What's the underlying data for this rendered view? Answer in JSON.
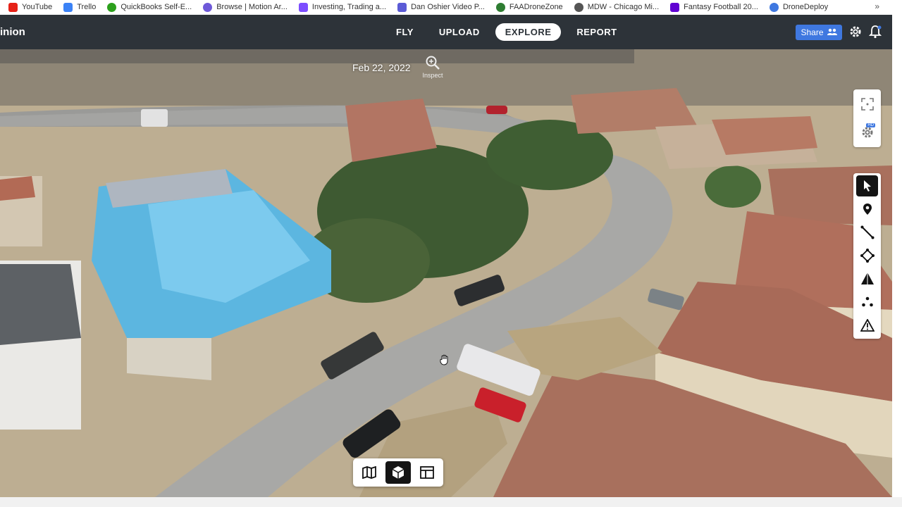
{
  "bookmarks": [
    {
      "label": "YouTube",
      "color": "#e62117"
    },
    {
      "label": "Trello",
      "color": "#3b82f6"
    },
    {
      "label": "QuickBooks Self-E...",
      "color": "#2ca01c"
    },
    {
      "label": "Browse | Motion Ar...",
      "color": "#6e59d9"
    },
    {
      "label": "Investing, Trading a...",
      "color": "#7c4dff"
    },
    {
      "label": "Dan Oshier Video P...",
      "color": "#5b5bd6"
    },
    {
      "label": "FAADroneZone",
      "color": "#2e7d32"
    },
    {
      "label": "MDW - Chicago Mi...",
      "color": "#555555"
    },
    {
      "label": "Fantasy Football 20...",
      "color": "#6001d2"
    },
    {
      "label": "DroneDeploy",
      "color": "#3f78e0"
    }
  ],
  "bookmarks_overflow": "»",
  "nav": {
    "project_title": "inion",
    "tabs": [
      {
        "label": "FLY",
        "active": false
      },
      {
        "label": "UPLOAD",
        "active": false
      },
      {
        "label": "EXPLORE",
        "active": true
      },
      {
        "label": "REPORT",
        "active": false
      }
    ],
    "share_label": "Share",
    "share_icon": "people-icon",
    "accent": "#3f78e0"
  },
  "map": {
    "date": "Feb 22, 2022",
    "inspect_label": "Inspect"
  },
  "right_panel_top": [
    {
      "name": "fit-view-icon"
    },
    {
      "name": "hd-settings-icon",
      "badge": "HD"
    }
  ],
  "right_tools": [
    {
      "name": "select-cursor-icon",
      "active": true
    },
    {
      "name": "location-pin-icon",
      "active": false
    },
    {
      "name": "line-measure-icon",
      "active": false
    },
    {
      "name": "area-measure-icon",
      "active": false
    },
    {
      "name": "volume-measure-icon",
      "active": false
    },
    {
      "name": "points-icon",
      "active": false
    },
    {
      "name": "issue-warning-icon",
      "active": false
    }
  ],
  "view_modes": [
    {
      "name": "map-2d-icon",
      "active": false
    },
    {
      "name": "model-3d-icon",
      "active": true
    },
    {
      "name": "layout-icon",
      "active": false
    }
  ]
}
